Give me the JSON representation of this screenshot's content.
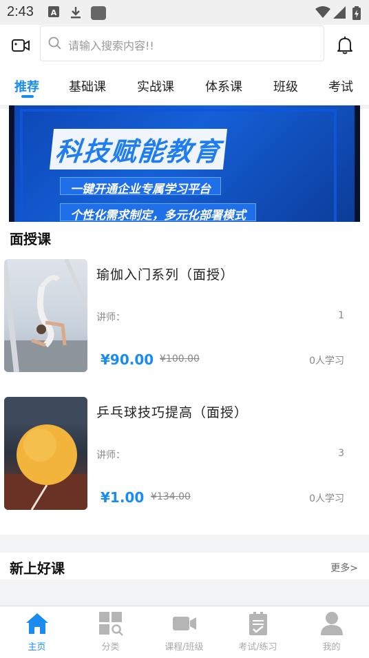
{
  "status_bar": {
    "time": "2:43"
  },
  "header": {
    "search_placeholder": "请输入搜索内容!!"
  },
  "tabs": [
    {
      "label": "推荐",
      "active": true
    },
    {
      "label": "基础课"
    },
    {
      "label": "实战课"
    },
    {
      "label": "体系课"
    },
    {
      "label": "班级"
    },
    {
      "label": "考试"
    }
  ],
  "banner": {
    "title": "科技赋能教育",
    "line1": "一键开通企业专属学习平台",
    "line2": "个性化需求制定，多元化部署模式"
  },
  "face_course_section": {
    "title": "面授课",
    "courses": [
      {
        "name": "瑜伽入门系列（面授）",
        "teacher_label": "讲师：",
        "count": "1",
        "price": "¥90.00",
        "old_price": "¥100.00",
        "learners": "0人学习"
      },
      {
        "name": "乒乓球技巧提高（面授）",
        "teacher_label": "讲师：",
        "count": "3",
        "price": "¥1.00",
        "old_price": "¥134.00",
        "learners": "0人学习"
      }
    ]
  },
  "new_section": {
    "title": "新上好课",
    "more": "更多>"
  },
  "bottom_nav": [
    {
      "label": "主页",
      "icon": "home-icon",
      "active": true
    },
    {
      "label": "分类",
      "icon": "category-icon"
    },
    {
      "label": "课程/班级",
      "icon": "video-icon"
    },
    {
      "label": "考试/练习",
      "icon": "clipboard-icon"
    },
    {
      "label": "我的",
      "icon": "profile-icon"
    }
  ],
  "colors": {
    "accent": "#1a8cf0",
    "nav_inactive": "#aaaaaa"
  }
}
